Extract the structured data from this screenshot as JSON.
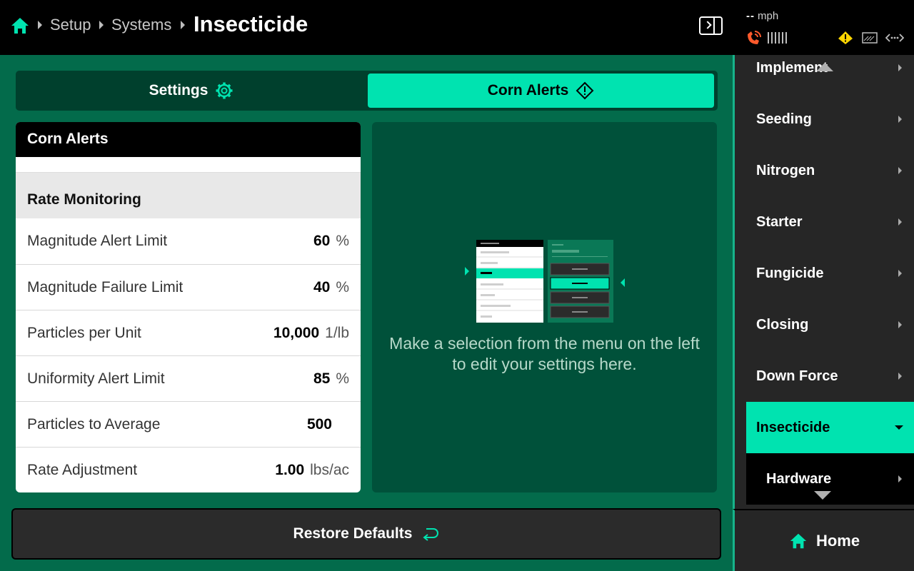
{
  "breadcrumb": {
    "items": [
      "Setup",
      "Systems"
    ],
    "current": "Insecticide"
  },
  "status": {
    "speed_value": "--",
    "speed_unit": "mph"
  },
  "tabs": {
    "settings": "Settings",
    "corn_alerts": "Corn Alerts"
  },
  "card": {
    "title": "Corn Alerts",
    "section": "Rate Monitoring",
    "rows": [
      {
        "label": "Magnitude Alert Limit",
        "value": "60",
        "unit": "%"
      },
      {
        "label": "Magnitude Failure Limit",
        "value": "40",
        "unit": "%"
      },
      {
        "label": "Particles per Unit",
        "value": "10,000",
        "unit": "1/lb"
      },
      {
        "label": "Uniformity Alert Limit",
        "value": "85",
        "unit": "%"
      },
      {
        "label": "Particles to Average",
        "value": "500",
        "unit": ""
      },
      {
        "label": "Rate Adjustment",
        "value": "1.00",
        "unit": "lbs/ac"
      }
    ]
  },
  "info": {
    "message": "Make a selection from the menu on the left to edit your settings here."
  },
  "restore": {
    "label": "Restore Defaults"
  },
  "sidebar": {
    "items": [
      {
        "label": "Implement"
      },
      {
        "label": "Seeding"
      },
      {
        "label": "Nitrogen"
      },
      {
        "label": "Starter"
      },
      {
        "label": "Fungicide"
      },
      {
        "label": "Closing"
      },
      {
        "label": "Down Force"
      },
      {
        "label": "Insecticide",
        "active": true
      },
      {
        "label": "Hardware",
        "sub": true
      }
    ]
  },
  "home": {
    "label": "Home"
  },
  "colors": {
    "accent": "#00e3b0",
    "background": "#036b4b",
    "panel": "#00513a",
    "topbar": "#000000",
    "sidebar": "#262626",
    "warning": "#ffd600",
    "gps_alert": "#ff5a2c"
  },
  "icons": [
    "home-icon",
    "gear-icon",
    "diamond-alert-icon",
    "panel-toggle-icon",
    "gps-disconnected-icon",
    "warning-icon",
    "display-icon",
    "connection-icon",
    "restore-icon"
  ]
}
